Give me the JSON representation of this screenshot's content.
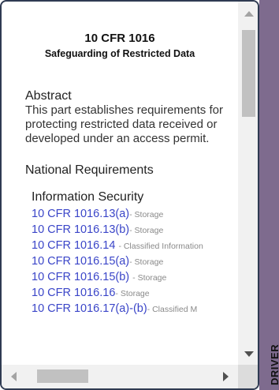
{
  "document": {
    "title": "10 CFR 1016",
    "subtitle": "Safeguarding of Restricted Data",
    "abstract_heading": "Abstract",
    "abstract_body": "This part establishes requirements for protecting restricted data received or developed under an access permit.",
    "national_heading": "National Requirements",
    "section_heading": "Information Security",
    "references": [
      {
        "link": "10 CFR 1016.13(a)",
        "desc": "- Storage"
      },
      {
        "link": "10 CFR 1016.13(b)",
        "desc": "- Storage"
      },
      {
        "link": "10 CFR 1016.14 ",
        "desc": "- Classified Information"
      },
      {
        "link": "10 CFR 1016.15(a)",
        "desc": "- Storage"
      },
      {
        "link": "10 CFR 1016.15(b) ",
        "desc": "- Storage"
      },
      {
        "link": "10 CFR 1016.16",
        "desc": "- Storage"
      },
      {
        "link": "10 CFR 1016.17(a)-(b)",
        "desc": "- Classified M"
      }
    ]
  },
  "side_tab": {
    "label": "DRIVER",
    "color": "#7e6b8e"
  },
  "colors": {
    "link": "#3a45c8",
    "border": "#2f3b52"
  }
}
